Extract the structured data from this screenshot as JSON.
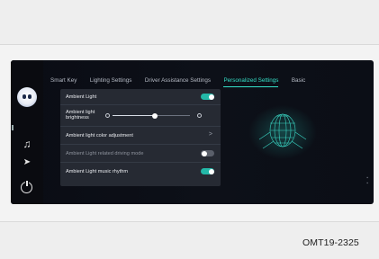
{
  "tabs": [
    {
      "label": "Smart Key",
      "active": false
    },
    {
      "label": "Lighting Settings",
      "active": false
    },
    {
      "label": "Driver Assistance Settings",
      "active": false
    },
    {
      "label": "Personalized Settings",
      "active": true
    },
    {
      "label": "Basic",
      "active": false
    }
  ],
  "settings": {
    "ambient_light": {
      "label": "Ambient Light",
      "toggle": "on"
    },
    "brightness": {
      "label_line1": "Ambient light",
      "label_line2": "brightness",
      "level": 0.55
    },
    "color_adjustment": {
      "label": "Ambient light color adjustment"
    },
    "driving_mode": {
      "label": "Ambient Light related driving mode",
      "toggle": "off"
    },
    "music_rhythm": {
      "label": "Ambient Light music rhythm",
      "toggle": "on"
    }
  },
  "icons": {
    "avatar": "assistant-avatar-icon",
    "music": "music-note-icon",
    "navigation": "navigation-arrow-icon",
    "power": "power-icon",
    "chevron": "chevron-right-icon",
    "brightness_low": "brightness-low-icon",
    "brightness_high": "brightness-high-icon",
    "hud": "head-wireframe-icon"
  },
  "colors": {
    "accent": "#35e0c8",
    "toggle_on": "#23b8a8",
    "screen_bg": "#0b0e16",
    "panel_bg": "#262a33"
  },
  "caption": "OMT19-2325"
}
